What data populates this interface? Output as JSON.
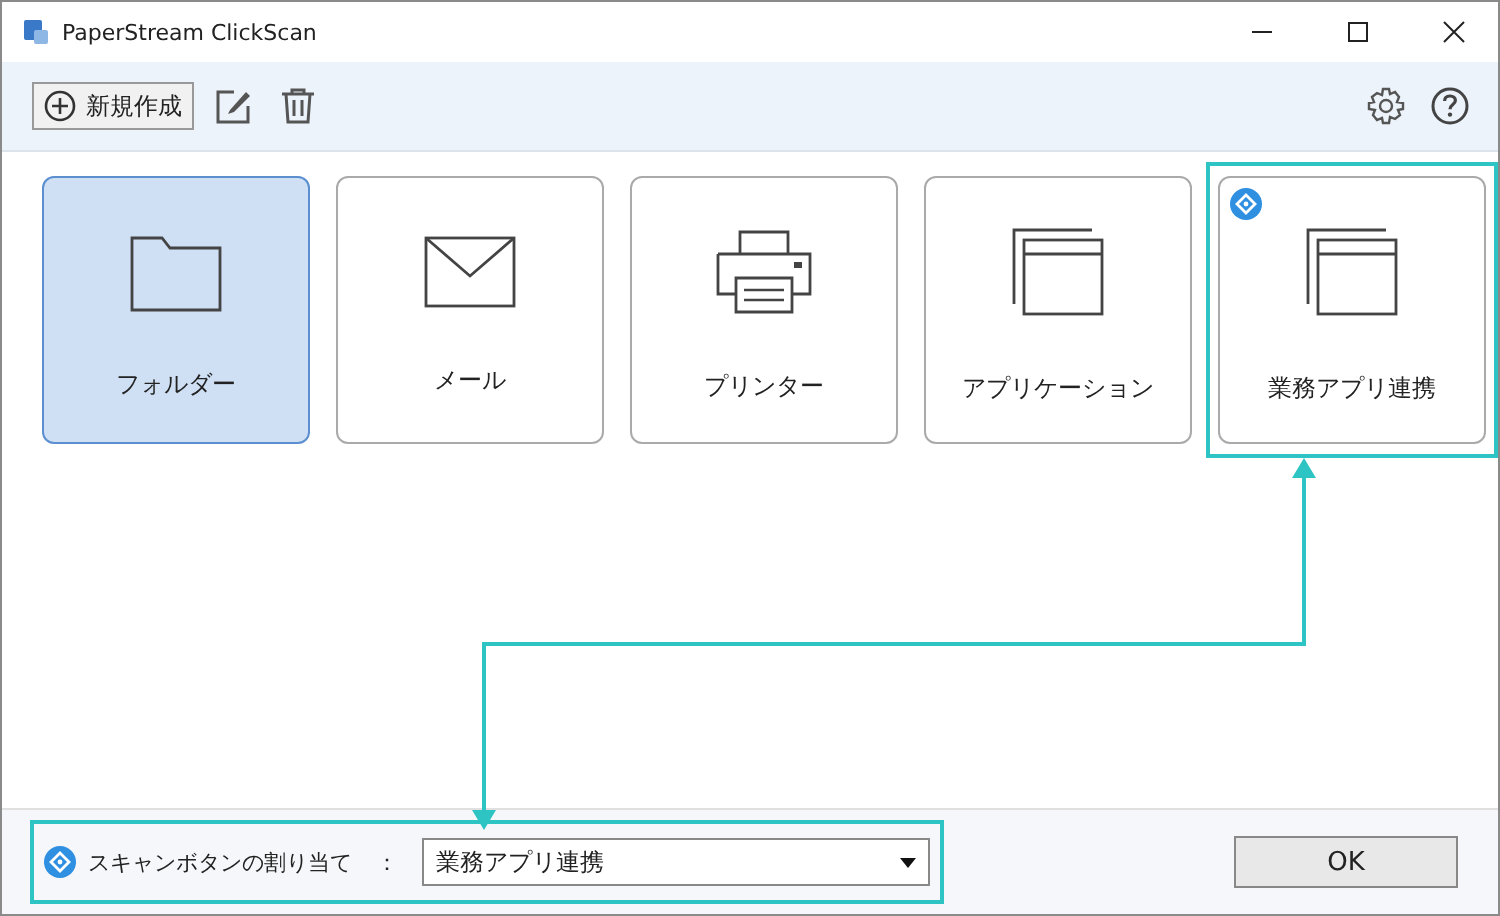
{
  "window": {
    "title": "PaperStream ClickScan"
  },
  "toolbar": {
    "new_button": "新規作成"
  },
  "tiles": [
    {
      "label": "フォルダー",
      "kind": "folder",
      "selected": true,
      "badge": false,
      "highlighted": false
    },
    {
      "label": "メール",
      "kind": "mail",
      "selected": false,
      "badge": false,
      "highlighted": false
    },
    {
      "label": "プリンター",
      "kind": "printer",
      "selected": false,
      "badge": false,
      "highlighted": false
    },
    {
      "label": "アプリケーション",
      "kind": "app",
      "selected": false,
      "badge": false,
      "highlighted": false
    },
    {
      "label": "業務アプリ連携",
      "kind": "app",
      "selected": false,
      "badge": true,
      "highlighted": true
    }
  ],
  "scan_button_assignment": {
    "label": "スキャンボタンの割り当て",
    "separator": "：",
    "value": "業務アプリ連携",
    "highlighted": true
  },
  "ok_button": "OK"
}
